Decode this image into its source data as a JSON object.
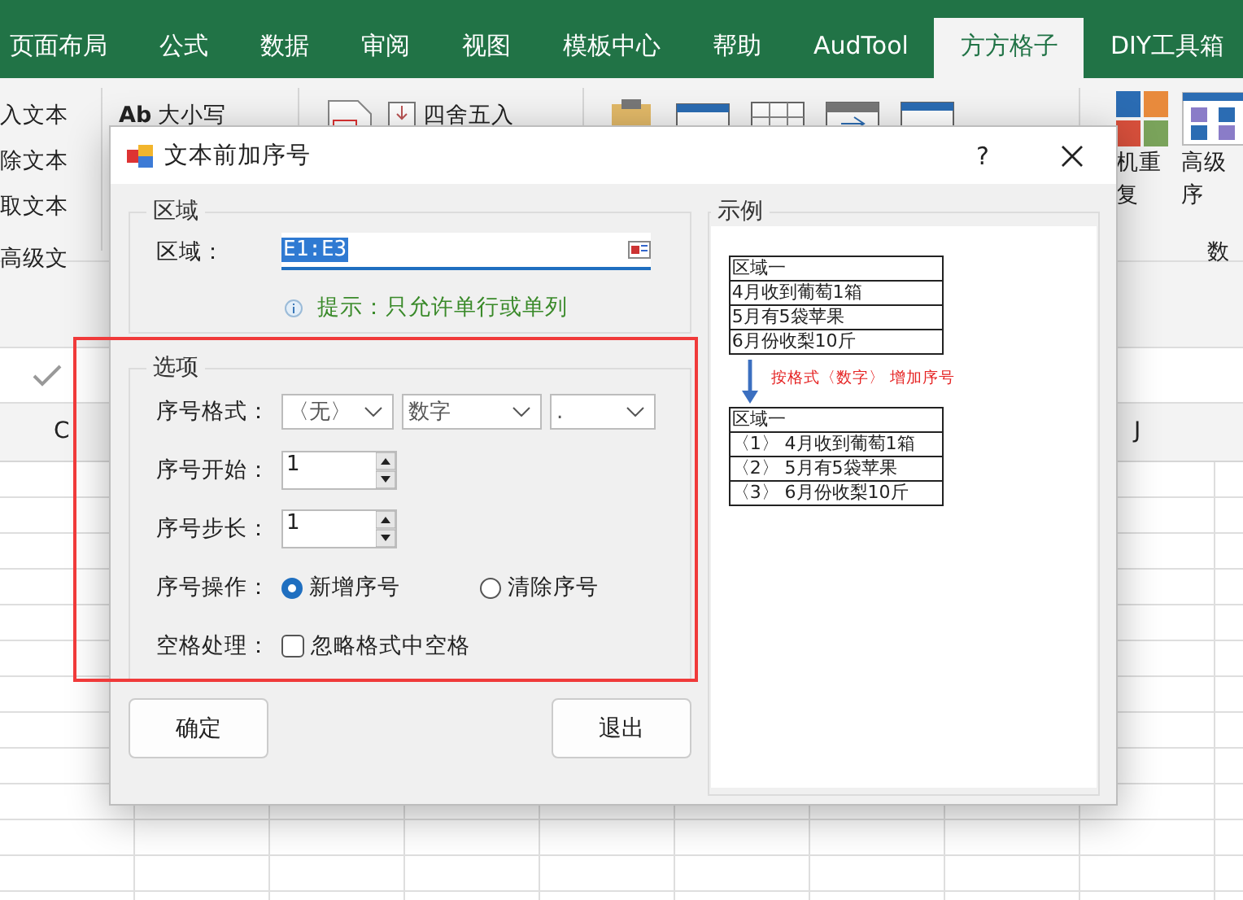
{
  "ribbon_tabs": [
    {
      "label": "页面布局",
      "selected": false
    },
    {
      "label": "公式",
      "selected": false
    },
    {
      "label": "数据",
      "selected": false
    },
    {
      "label": "审阅",
      "selected": false
    },
    {
      "label": "视图",
      "selected": false
    },
    {
      "label": "模板中心",
      "selected": false
    },
    {
      "label": "帮助",
      "selected": false
    },
    {
      "label": "AudTool",
      "selected": false
    },
    {
      "label": "方方格子",
      "selected": true
    },
    {
      "label": "DIY工具箱",
      "selected": false
    }
  ],
  "ribbon": {
    "text_commands": [
      "入文本",
      "除文本",
      "取文本"
    ],
    "group_label": "高级文",
    "case_command": {
      "icon_text": "Ab",
      "label": "大小写"
    },
    "round_command": "四舍五入",
    "shuffle_command": [
      "机重",
      "复"
    ],
    "sort_command": [
      "高级",
      "序"
    ],
    "right_group_label": "数"
  },
  "sheet": {
    "columns": [
      {
        "label": "C"
      },
      {
        "label": "J"
      }
    ]
  },
  "dialog": {
    "title": "文本前加序号",
    "help": "?",
    "region_group": {
      "legend": "区域",
      "label": "区域：",
      "value": "E1:E3",
      "hint": "提示：只允许单行或单列"
    },
    "options_group": {
      "legend": "选项",
      "format": {
        "label": "序号格式：",
        "selects": [
          "〈无〉",
          "数字",
          "."
        ]
      },
      "start": {
        "label": "序号开始：",
        "value": "1"
      },
      "step": {
        "label": "序号步长：",
        "value": "1"
      },
      "operation": {
        "label": "序号操作：",
        "options": [
          {
            "label": "新增序号",
            "selected": true
          },
          {
            "label": "清除序号",
            "selected": false
          }
        ]
      },
      "spaces": {
        "label": "空格处理：",
        "option": {
          "label": "忽略格式中空格",
          "checked": false
        }
      }
    },
    "buttons": [
      "确定",
      "退出"
    ],
    "example": {
      "legend": "示例",
      "before": [
        "区域一",
        "4月收到葡萄1箱",
        "5月有5袋苹果",
        "6月份收梨10斤"
      ],
      "note": "按格式〈数字〉 增加序号",
      "after": [
        "区域一",
        "〈1〉 4月收到葡萄1箱",
        "〈2〉 5月有5袋苹果",
        "〈3〉 6月份收梨10斤"
      ]
    }
  },
  "annotation": {
    "kind": "highlight-frame"
  }
}
